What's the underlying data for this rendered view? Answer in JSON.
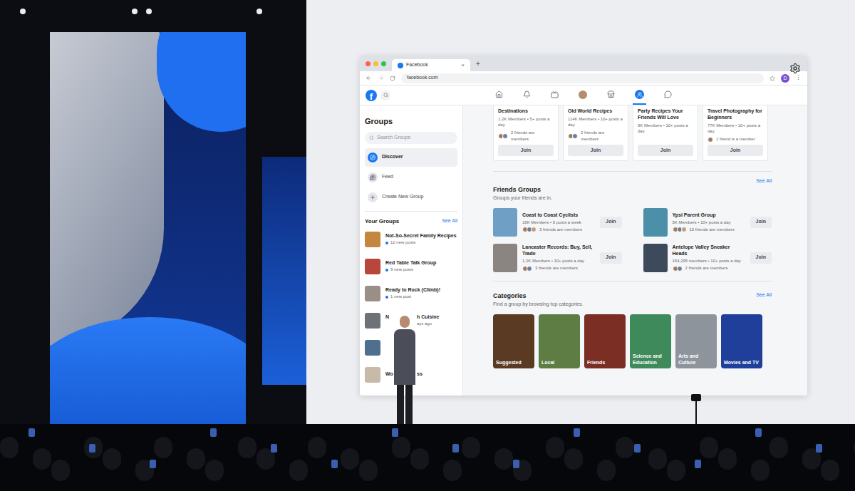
{
  "browser": {
    "tab_title": "Facebook",
    "tab_close": "×",
    "new_tab": "+",
    "url": "facebook.com",
    "profile_initial": "D",
    "menu": "⋮",
    "fb_logo": "f"
  },
  "nav": [
    {
      "selected": false
    },
    {
      "selected": false
    },
    {
      "selected": false
    },
    {
      "selected": false
    },
    {
      "selected": false
    },
    {
      "selected": true
    },
    {
      "selected": false
    }
  ],
  "sidebar": {
    "title": "Groups",
    "search_placeholder": "Search Groups",
    "items": [
      {
        "label": "Discover",
        "selected": true
      },
      {
        "label": "Feed",
        "selected": false
      },
      {
        "label": "Create New Group",
        "selected": false
      }
    ],
    "your_groups_title": "Your Groups",
    "see_all": "See All",
    "groups": [
      {
        "occluded": false,
        "name_before": "Not-So-Secret Family Recipes",
        "name_after": "",
        "activity_before": "12 new posts",
        "activity_after": "",
        "unread": true
      },
      {
        "occluded": false,
        "name_before": "Red Table Talk Group",
        "name_after": "",
        "activity_before": "9 new posts",
        "activity_after": "",
        "unread": true
      },
      {
        "occluded": false,
        "name_before": "Ready to Rock (Climb)!",
        "name_after": "",
        "activity_before": "1 new post",
        "activity_after": "",
        "unread": true
      },
      {
        "occluded": true,
        "name_before": "N",
        "name_after": "h Cuisine",
        "activity_before": "",
        "activity_after": "ays ago",
        "unread": false
      },
      {
        "occluded": true,
        "name_before": "",
        "name_after": "",
        "activity_before": "",
        "activity_after": "",
        "unread": false
      },
      {
        "occluded": true,
        "name_before": "Wo",
        "name_after": "ss",
        "activity_before": "",
        "activity_after": "",
        "unread": false
      }
    ]
  },
  "suggested_cards": [
    {
      "title_lines": [
        "Destinations"
      ],
      "meta": "1.2K Members • 5+ posts a day",
      "friends": "2 friends are members",
      "avatars": 2,
      "join": "Join"
    },
    {
      "title_lines": [
        "Old World Recipes"
      ],
      "meta": "114K Members • 10+ posts a day",
      "friends": "2 friends are members",
      "avatars": 2,
      "join": "Join"
    },
    {
      "title_lines": [
        "Party Recipes Your",
        "Friends Will Love"
      ],
      "meta": "9K Members • 10+ posts a day",
      "friends": "",
      "avatars": 0,
      "join": "Join"
    },
    {
      "title_lines": [
        "Travel Photography for",
        "Beginners"
      ],
      "meta": "77K Members • 10+ posts a day",
      "friends": "1 friend is a member",
      "avatars": 1,
      "join": "Join"
    }
  ],
  "friends_groups": {
    "title": "Friends Groups",
    "subtitle": "Groups your friends are in.",
    "see_all": "See All",
    "items": [
      {
        "name": "Coast to Coast Cyclists",
        "meta": "16K Members • 5 posts a week",
        "friends": "3 friends are members",
        "avatars": 3,
        "join": "Join"
      },
      {
        "name": "Ypsi Parent Group",
        "meta": "5K Members • 10+ posts a day",
        "friends": "10 friends are members",
        "avatars": 3,
        "join": "Join"
      },
      {
        "name": "Lancaster Records: Buy, Sell, Trade",
        "meta": "1.2K Members • 10+ posts a day",
        "friends": "3 friends are members",
        "avatars": 2,
        "join": "Join"
      },
      {
        "name": "Antelope Valley Sneaker Heads",
        "meta": "154,295 members • 10+ posts a day",
        "friends": "2 friends are members",
        "avatars": 2,
        "join": "Join"
      }
    ]
  },
  "categories": {
    "title": "Categories",
    "subtitle": "Find a group by browsing top categories.",
    "see_all": "See All",
    "tiles": [
      "Suggested",
      "Local",
      "Friends",
      "Science and Education",
      "Arts and Culture",
      "Movies and TV"
    ]
  }
}
